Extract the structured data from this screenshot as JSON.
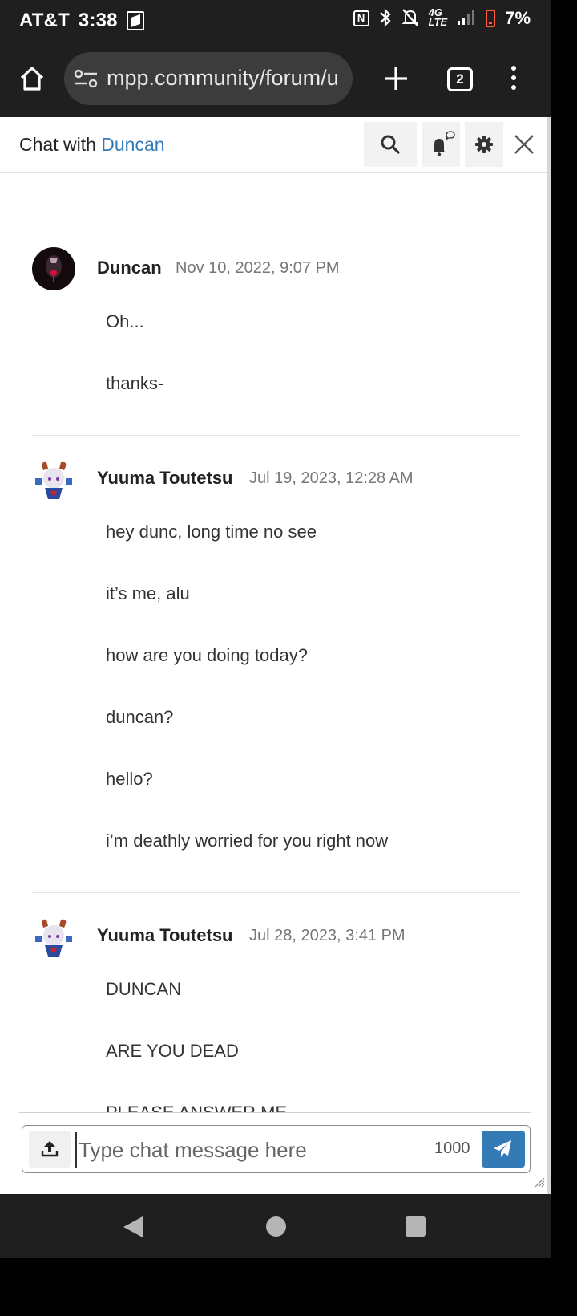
{
  "status_bar": {
    "carrier": "AT&T",
    "time": "3:38",
    "network": "4G LTE",
    "battery": "7%"
  },
  "browser": {
    "url": "mpp.community/forum/u",
    "tab_count": "2"
  },
  "chat": {
    "title_prefix": "Chat with",
    "partner": "Duncan"
  },
  "messages": [
    {
      "author": "Duncan",
      "timestamp": "Nov 10, 2022, 9:07 PM",
      "avatar": "dark-avatar",
      "lines": [
        "Oh...",
        "thanks-"
      ]
    },
    {
      "author": "Yuuma Toutetsu",
      "timestamp": "Jul 19, 2023, 12:28 AM",
      "avatar": "anime-avatar",
      "lines": [
        "hey dunc, long time no see",
        "it’s me, alu",
        "how are you doing today?",
        "duncan?",
        "hello?",
        "i’m deathly worried for you right now"
      ]
    },
    {
      "author": "Yuuma Toutetsu",
      "timestamp": "Jul 28, 2023, 3:41 PM",
      "avatar": "anime-avatar",
      "lines": [
        "DUNCAN",
        "ARE YOU DEAD",
        "PLEASE ANSWER ME"
      ]
    }
  ],
  "composer": {
    "placeholder": "Type chat message here",
    "char_count": "1000"
  },
  "colors": {
    "link": "#337ab7",
    "send_button": "#337ab7",
    "battery_low": "#ff5a3c"
  }
}
